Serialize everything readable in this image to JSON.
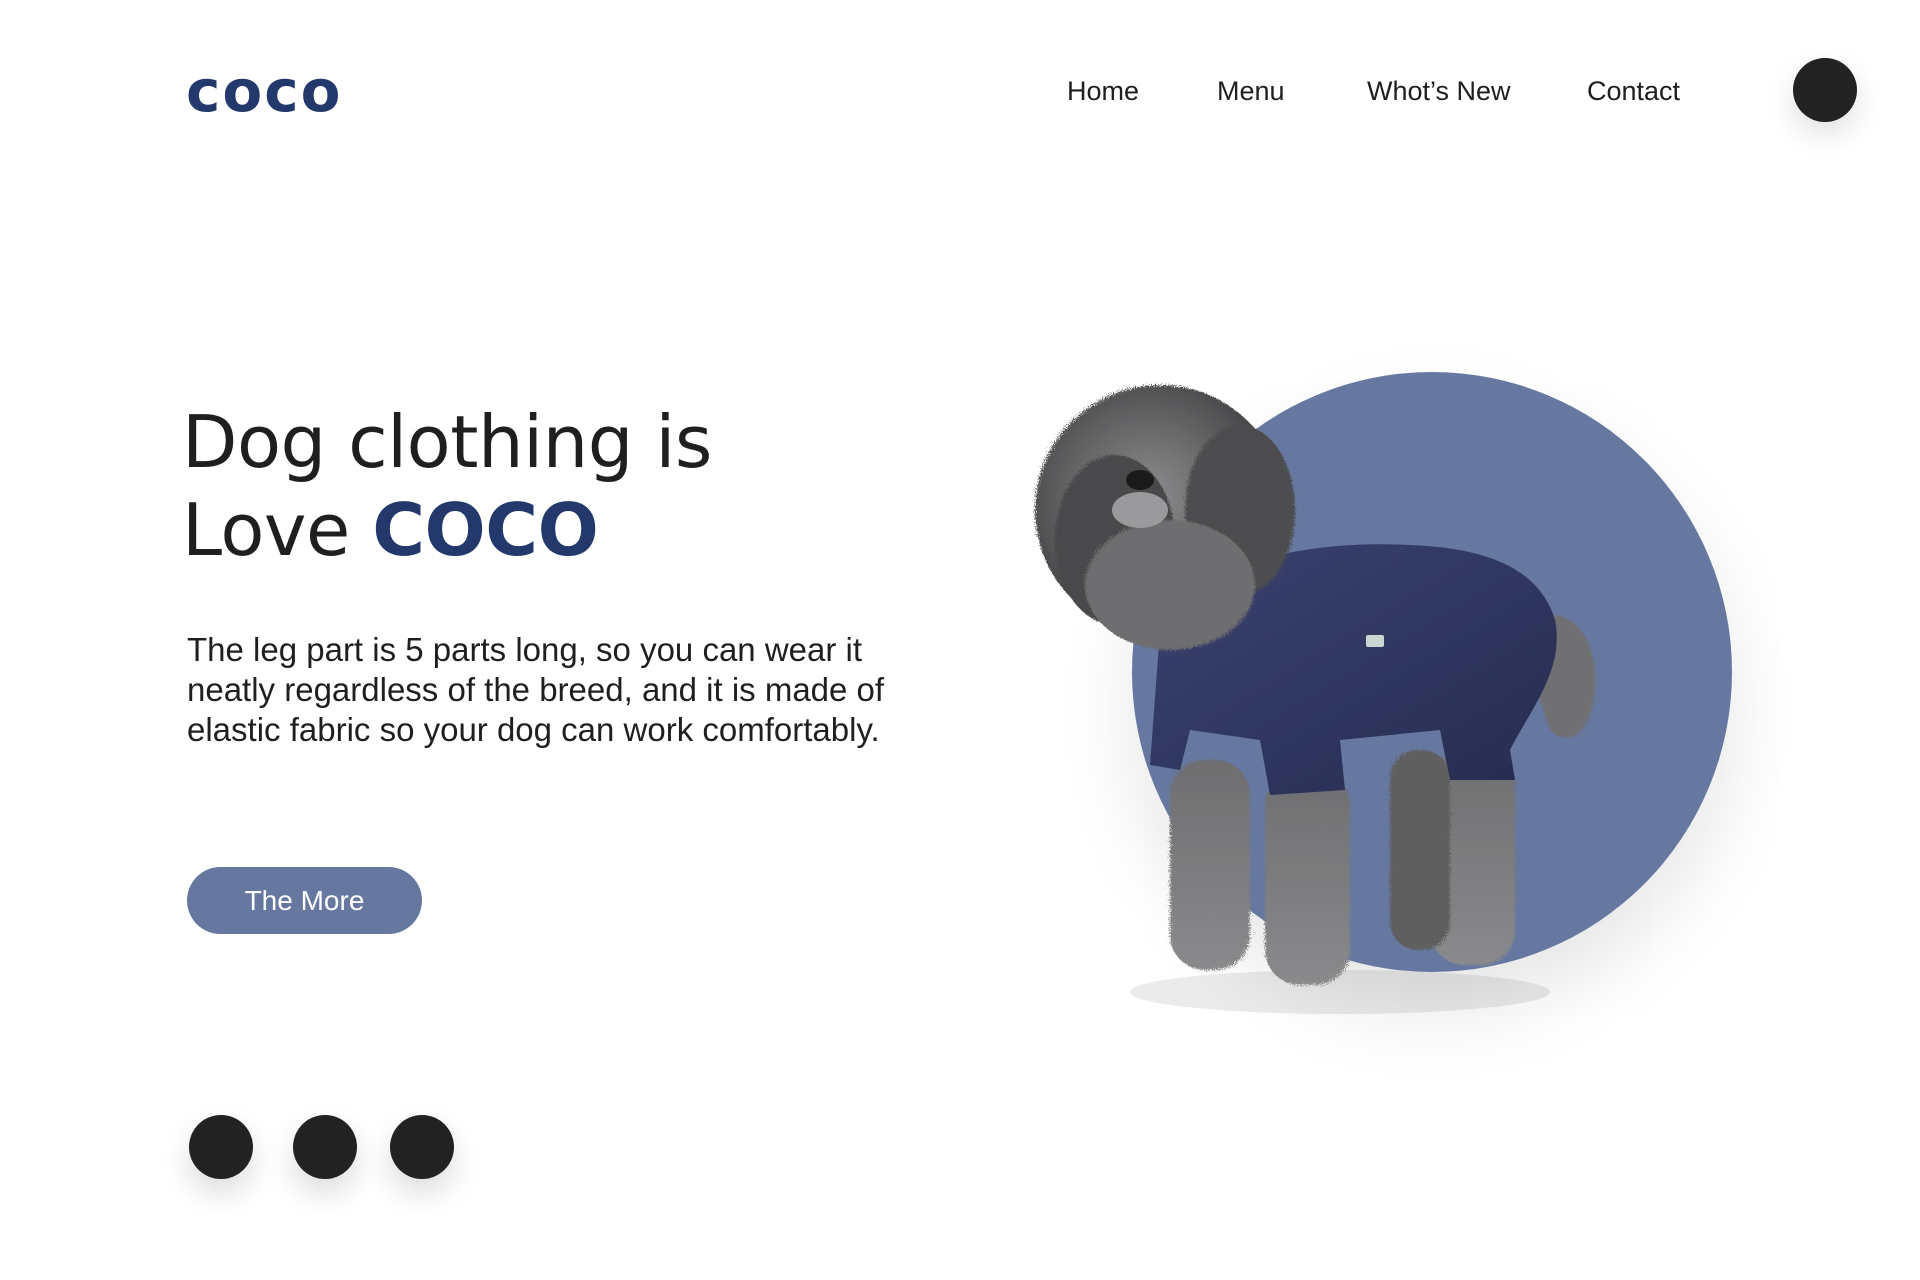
{
  "brand": {
    "logo_text": "coco"
  },
  "nav": {
    "items": [
      "Home",
      "Menu",
      "Whot’s New",
      "Contact"
    ]
  },
  "hero": {
    "headline_line1": "Dog clothing is",
    "headline_line2_prefix": "Love ",
    "headline_line2_accent": "COCO",
    "description": "The leg part is 5 parts long, so you can wear it neatly regardless of the breed, and it is made of elastic fabric so your dog can work comfortably.",
    "cta_label": "The More"
  },
  "carousel": {
    "dot_count": 3
  },
  "colors": {
    "brand_navy": "#23386b",
    "accent_slate": "#6677a0",
    "text_dark": "#222222",
    "background": "#ffffff"
  },
  "icons": {
    "profile": "avatar-circle",
    "hero_image": "poodle-in-navy-onesie"
  }
}
